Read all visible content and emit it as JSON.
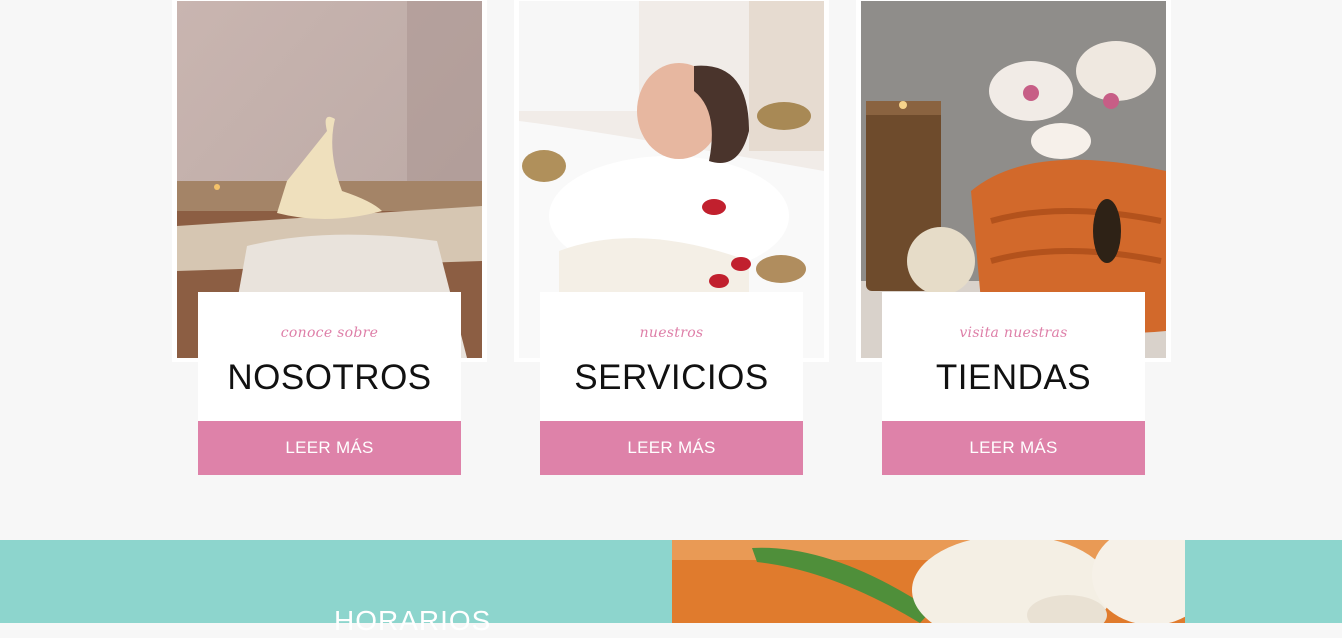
{
  "cards": [
    {
      "eyebrow": "conoce sobre",
      "title": "NOSOTROS",
      "button": "LEER MÁS"
    },
    {
      "eyebrow": "nuestros",
      "title": "SERVICIOS",
      "button": "LEER MÁS"
    },
    {
      "eyebrow": "visita nuestras",
      "title": "TIENDAS",
      "button": "LEER MÁS"
    }
  ],
  "hours_section": {
    "title": "HORARIOS"
  },
  "colors": {
    "accent_pink": "#de82a9",
    "teal_band": "#8dd5cd",
    "eyebrow_pink": "#de7fa8"
  }
}
